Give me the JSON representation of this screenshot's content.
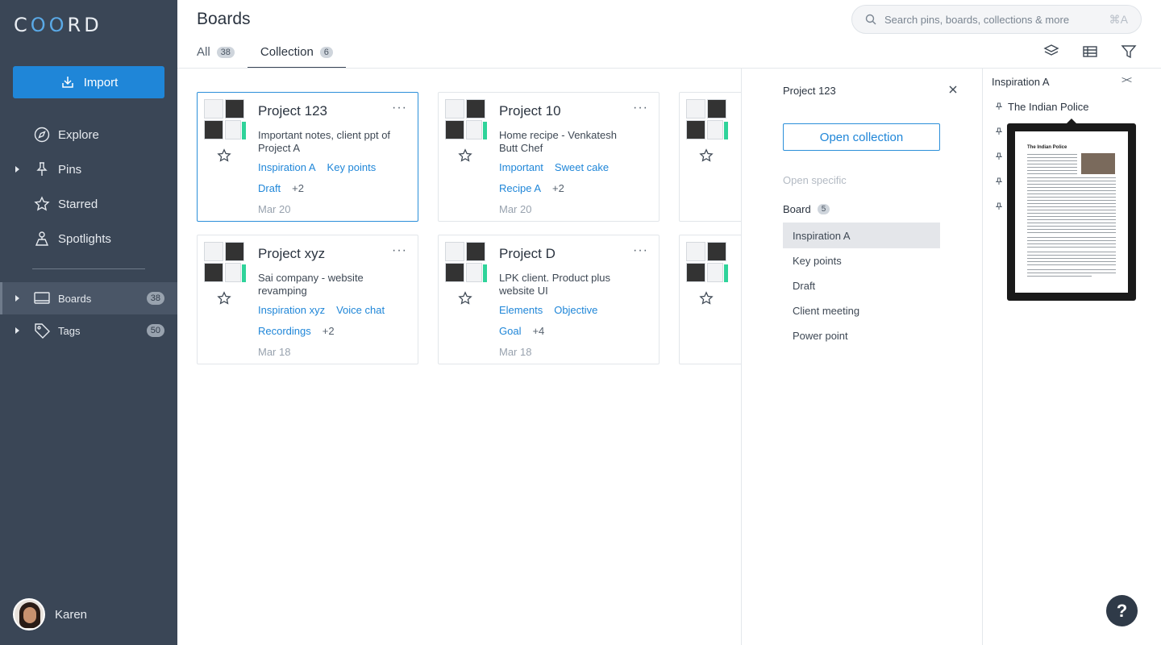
{
  "app": {
    "logo": "COORD"
  },
  "sidebar": {
    "import_label": "Import",
    "items": [
      {
        "label": "Explore"
      },
      {
        "label": "Pins"
      },
      {
        "label": "Starred"
      },
      {
        "label": "Spotlights"
      }
    ],
    "boards": {
      "label": "Boards",
      "count": "38"
    },
    "tags": {
      "label": "Tags",
      "count": "50"
    },
    "user": {
      "name": "Karen"
    }
  },
  "header": {
    "title": "Boards",
    "search_placeholder": "Search pins, boards, collections & more",
    "search_shortcut": "⌘A",
    "tabs": [
      {
        "label": "All",
        "count": "38"
      },
      {
        "label": "Collection",
        "count": "6"
      }
    ]
  },
  "cards": [
    {
      "title": "Project 123",
      "desc": "Important notes, client ppt of Project A",
      "tags1": [
        "Inspiration A",
        "Key points"
      ],
      "tags2": [
        "Draft"
      ],
      "more": "+2",
      "date": "Mar 20"
    },
    {
      "title": "Project 10",
      "desc": "Home recipe - Venkatesh Butt Chef",
      "tags1": [
        "Important",
        "Sweet cake"
      ],
      "tags2": [
        "Recipe A"
      ],
      "more": "+2",
      "date": "Mar 20"
    },
    {
      "title": "Project xyz",
      "desc": "Sai company - website revamping",
      "tags1": [
        "Inspiration xyz",
        "Voice chat"
      ],
      "tags2": [
        "Recordings"
      ],
      "more": "+2",
      "date": "Mar 18"
    },
    {
      "title": "Project D",
      "desc": "LPK client. Product plus website UI",
      "tags1": [
        "Elements",
        "Objective"
      ],
      "tags2": [
        "Goal"
      ],
      "more": "+4",
      "date": "Mar 18"
    }
  ],
  "panel": {
    "title": "Project 123",
    "open_label": "Open collection",
    "open_specific": "Open specific",
    "board_label": "Board",
    "board_count": "5",
    "boards": [
      "Inspiration A",
      "Key points",
      "Draft",
      "Client meeting",
      "Power point"
    ]
  },
  "viewer": {
    "title": "Inspiration A",
    "pin_name": "The Indian Police",
    "doc_title": "The Indian Police"
  },
  "help": {
    "label": "?"
  }
}
